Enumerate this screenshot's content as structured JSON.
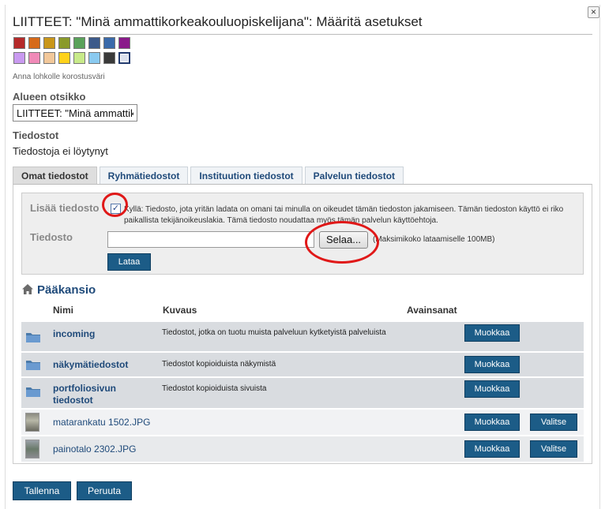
{
  "dialog": {
    "title": "LIITTEET: \"Minä ammattikorkeakouluopiskelijana\": Määritä asetukset",
    "close_glyph": "×"
  },
  "swatches": {
    "row1": [
      "#b52a2a",
      "#d66a1a",
      "#c9961a",
      "#8a9a2a",
      "#5aa25a",
      "#3c5a8a",
      "#3a6aaa",
      "#8a1a8a"
    ],
    "row2": [
      "#c99af0",
      "#f08ab8",
      "#f2c89a",
      "#ffd21a",
      "#c8ea8a",
      "#8acaf0",
      "#3a3a3a",
      "#dde2ee"
    ],
    "selected_index": 15,
    "label": "Anna lohkolle korostusväri"
  },
  "heading": {
    "label": "Alueen otsikko",
    "value": "LIITTEET: \"Minä ammattik"
  },
  "files": {
    "label": "Tiedostot",
    "empty_text": "Tiedostoja ei löytynyt"
  },
  "tabs": [
    {
      "label": "Omat tiedostot",
      "active": true
    },
    {
      "label": "Ryhmätiedostot",
      "active": false
    },
    {
      "label": "Instituution tiedostot",
      "active": false
    },
    {
      "label": "Palvelun tiedostot",
      "active": false
    }
  ],
  "upload": {
    "add_file_label": "Lisää tiedosto",
    "checkbox_checked": true,
    "checkbox_glyph": "✓",
    "consent_text": "Kyllä: Tiedosto, jota yritän ladata on omani tai minulla on oikeudet tämän tiedoston jakamiseen. Tämän tiedoston käyttö ei riko paikallista tekijänoikeuslakia. Tämä tiedosto noudattaa myös tämän palvelun käyttöehtoja.",
    "file_label": "Tiedosto",
    "browse_label": "Selaa...",
    "max_size": "(Maksimikoko lataamiselle 100MB)",
    "upload_button": "Lataa"
  },
  "folder": {
    "title": "Pääkansio",
    "columns": {
      "name": "Nimi",
      "description": "Kuvaus",
      "tags": "Avainsanat"
    },
    "rows": [
      {
        "name": "incoming",
        "description": "Tiedostot, jotka on tuotu muista palveluun kytketyistä palveluista",
        "edit": "Muokkaa",
        "select": "",
        "kind": "folder"
      },
      {
        "name": "näkymätiedostot",
        "description": "Tiedostot kopioiduista näkymistä",
        "edit": "Muokkaa",
        "select": "",
        "kind": "folder"
      },
      {
        "name": "portfoliosivun tiedostot",
        "description": "Tiedostot kopioiduista sivuista",
        "edit": "Muokkaa",
        "select": "",
        "kind": "folder"
      },
      {
        "name": "matarankatu 1502.JPG",
        "description": "",
        "edit": "Muokkaa",
        "select": "Valitse",
        "kind": "image"
      },
      {
        "name": "painotalo 2302.JPG",
        "description": "",
        "edit": "Muokkaa",
        "select": "Valitse",
        "kind": "image"
      }
    ]
  },
  "footer": {
    "save": "Tallenna",
    "cancel": "Peruuta"
  },
  "colors": {
    "accent": "#1c5c87",
    "link": "#1f4a7a",
    "annotation": "#e01818"
  }
}
